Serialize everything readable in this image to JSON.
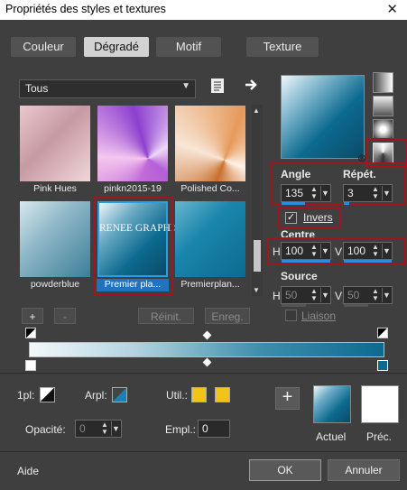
{
  "window": {
    "title": "Propriétés des styles et textures",
    "close_glyph": "✕"
  },
  "tabs": [
    {
      "label": "Couleur"
    },
    {
      "label": "Dégradé",
      "active": true
    },
    {
      "label": "Motif"
    },
    {
      "label": "Texture"
    }
  ],
  "library": {
    "filter_value": "Tous",
    "swatches": [
      {
        "name": "Pink Hues"
      },
      {
        "name": "pinkn2015-19"
      },
      {
        "name": "Polished Co..."
      },
      {
        "name": "powderblue"
      },
      {
        "name": "Premier pla...",
        "selected": true,
        "overlay_text": "RENEE GRAPHISME"
      },
      {
        "name": "Premierplan..."
      }
    ],
    "add_label": "+",
    "remove_label": "-",
    "reset_label": "Réinit.",
    "save_label": "Enreg."
  },
  "settings": {
    "angle_label": "Angle",
    "angle_value": "135",
    "repeat_label": "Répét.",
    "repeat_value": "3",
    "invert_label": "Invers",
    "invert_checked": true,
    "centre_label": "Centre",
    "centre_h_label": "H",
    "centre_h_value": "100",
    "centre_v_label": "V",
    "centre_v_value": "100",
    "source_label": "Source",
    "source_h_label": "H",
    "source_h_value": "50",
    "source_v_label": "V",
    "source_v_value": "50",
    "link_label": "Liaison"
  },
  "stops": {
    "opacity_label": "1pl:",
    "arpl_label": "Arpl:",
    "util_label": "Util.:",
    "opacite_label": "Opacité:",
    "opacite_value": "0",
    "empl_label": "Empl.:",
    "empl_value": "0"
  },
  "bottom": {
    "add_glyph": "+",
    "current_label": "Actuel",
    "previous_label": "Préc.",
    "help_label": "Aide",
    "ok_label": "OK",
    "cancel_label": "Annuler"
  },
  "colors": {
    "accent_blue": "#2b8de0",
    "highlight_red": "#a3151e",
    "stop_yellow": "#f2c418",
    "gradient_dark": "#0c6a8f"
  }
}
